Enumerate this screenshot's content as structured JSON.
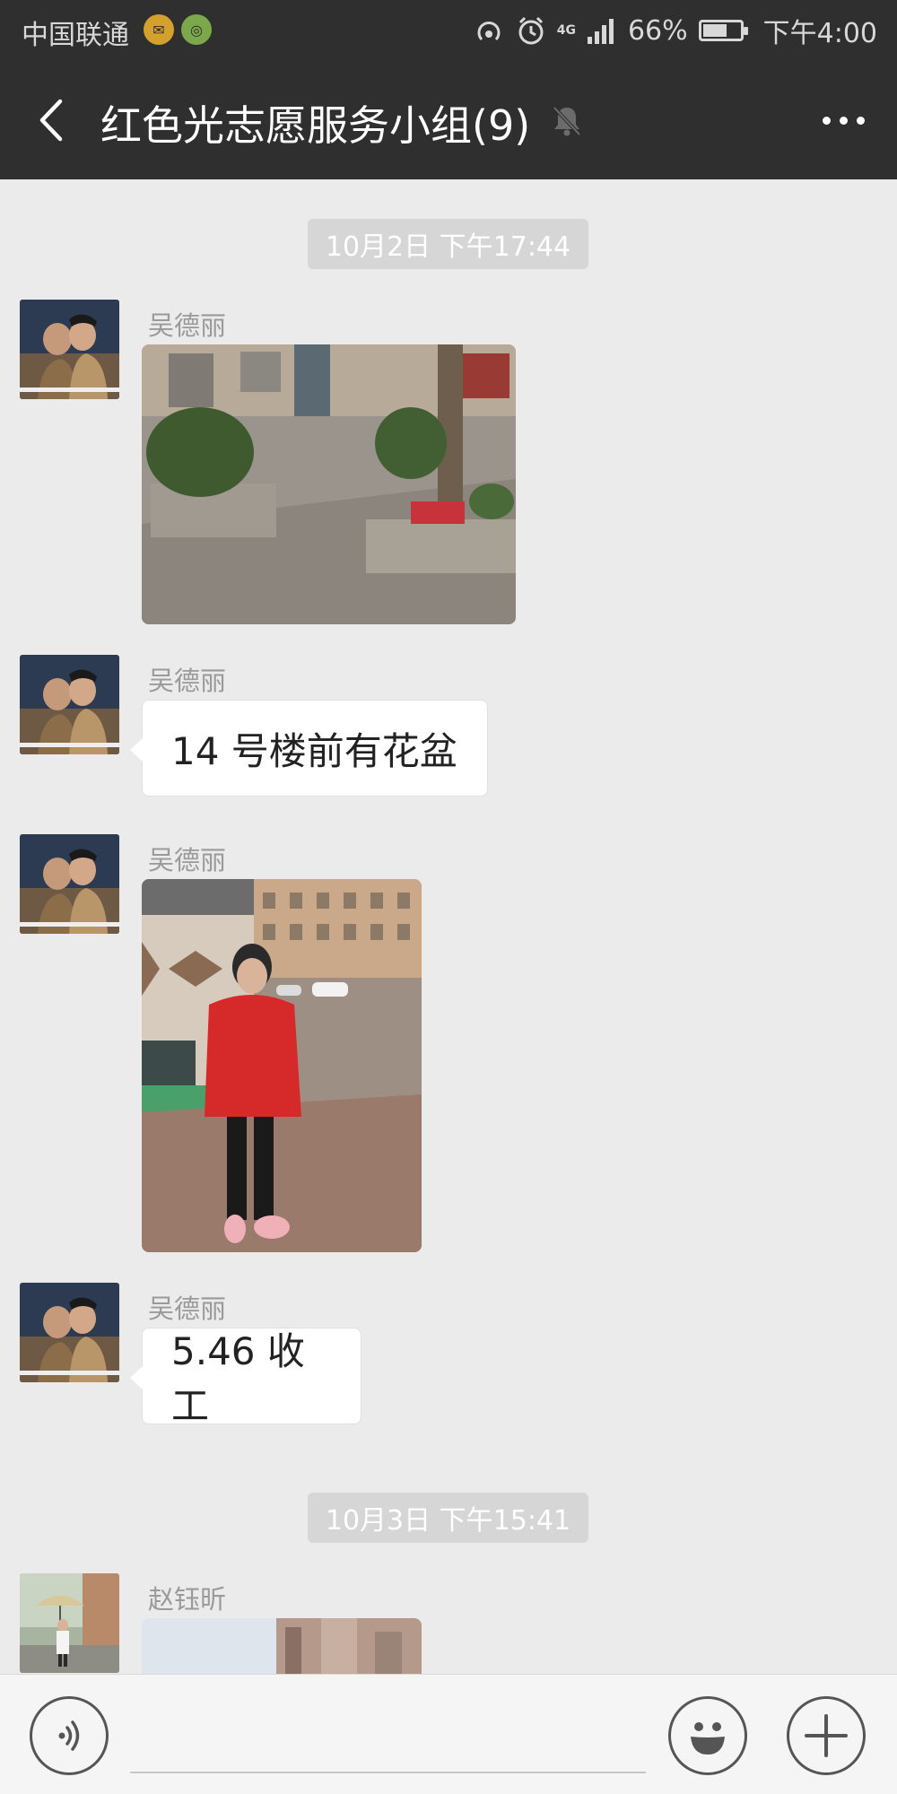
{
  "status_bar": {
    "carrier": "中国联通",
    "signal_text": "4G",
    "battery_percent": "66%",
    "battery_level": 0.66,
    "time": "下午4:00"
  },
  "header": {
    "title": "红色光志愿服务小组(9)"
  },
  "chat": {
    "time_separators": [
      "10月2日 下午17:44",
      "10月3日 下午15:41"
    ],
    "messages": [
      {
        "sender": "吴德丽",
        "type": "image"
      },
      {
        "sender": "吴德丽",
        "type": "text",
        "text": "14 号楼前有花盆"
      },
      {
        "sender": "吴德丽",
        "type": "image"
      },
      {
        "sender": "吴德丽",
        "type": "text",
        "text": "5.46 收工"
      },
      {
        "sender": "赵钰昕",
        "type": "image"
      }
    ]
  },
  "icons": {
    "back": "chevron-left-icon",
    "mute": "bell-off-icon",
    "more": "more-horizontal-icon",
    "voice": "voice-icon",
    "emoji": "emoji-icon",
    "plus": "plus-icon"
  },
  "colors": {
    "header_bg": "#2f2f2f",
    "chat_bg": "#ebebeb",
    "bubble_bg": "#ffffff",
    "time_badge_bg": "#d6d6d6"
  }
}
